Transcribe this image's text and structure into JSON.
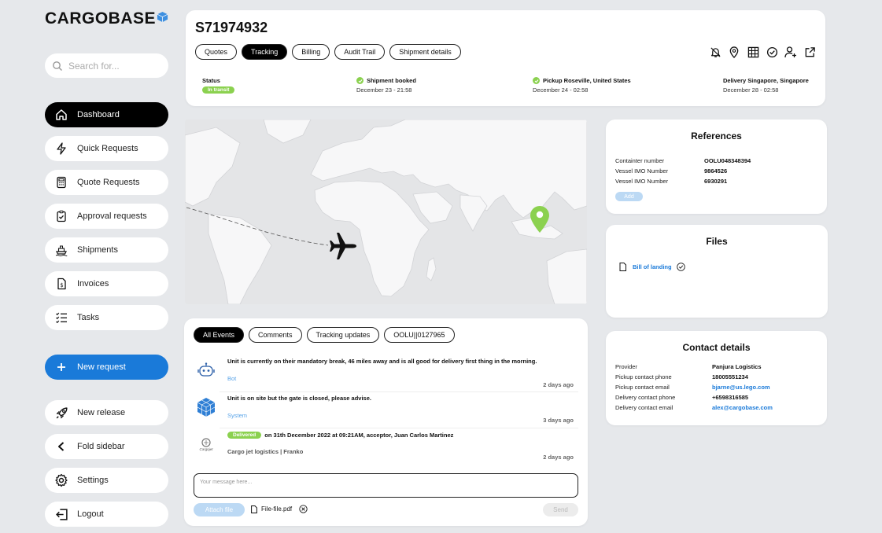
{
  "app": {
    "brand": "CARGOBASE"
  },
  "search": {
    "placeholder": "Search for..."
  },
  "sidebar": {
    "items": [
      {
        "label": "Dashboard"
      },
      {
        "label": "Quick Requests"
      },
      {
        "label": "Quote Requests"
      },
      {
        "label": "Approval requests"
      },
      {
        "label": "Shipments"
      },
      {
        "label": "Invoices"
      },
      {
        "label": "Tasks"
      }
    ],
    "new_request": "New request",
    "bottom": [
      {
        "label": "New release"
      },
      {
        "label": "Fold sidebar"
      },
      {
        "label": "Settings"
      },
      {
        "label": "Logout"
      }
    ]
  },
  "header": {
    "shipment_id": "S71974932",
    "tabs": [
      "Quotes",
      "Tracking",
      "Billing",
      "Audit Trail",
      "Shipment details"
    ],
    "status": {
      "label": "Status",
      "badge": "In transit",
      "booked_label": "Shipment booked",
      "booked_time": "December 23 - 21:58",
      "pickup_label": "Pickup Roseville, United States",
      "pickup_time": "December 24 - 02:58",
      "delivery_label": "Delivery Singapore, Singapore",
      "delivery_time": "December 28 - 02:58"
    }
  },
  "references": {
    "title": "References",
    "rows": [
      {
        "k": "Containter number",
        "v": "OOLU048348394"
      },
      {
        "k": "Vessel IMO Number",
        "v": "9864526"
      },
      {
        "k": "Vessel IMO Number",
        "v": "6930291"
      }
    ],
    "add_label": "Add"
  },
  "files": {
    "title": "Files",
    "items": [
      {
        "name": "Bill of landing"
      }
    ]
  },
  "contact": {
    "title": "Contact details",
    "rows": [
      {
        "k": "Provider",
        "v": "Panjura Logistics"
      },
      {
        "k": "Pickup contact phone",
        "v": "18005551234"
      },
      {
        "k": "Pickup contact email",
        "v": "bjarne@us.lego.com"
      },
      {
        "k": "Delivery contact phone",
        "v": "+6598316585"
      },
      {
        "k": "Delivery contact email",
        "v": "alex@cargobase.com"
      }
    ]
  },
  "events": {
    "tabs": [
      "All Events",
      "Comments",
      "Tracking updates",
      "OOLU||0127965"
    ],
    "items": [
      {
        "text": "Unit is currently on their mandatory break, 46 miles away and is all good for delivery first thing in the morning.",
        "source": "Bot",
        "time": "2 days ago"
      },
      {
        "text": "Unit is on site but the gate is closed, please advise.",
        "source": "System",
        "time": "3 days ago"
      },
      {
        "badge": "Delivered",
        "text": "on 31th December 2022 at 09:21AM, acceptor, Juan Carlos Martinez",
        "source": "Cargo jet logistics | Franko",
        "time": "2 days ago",
        "avatar_text": "Cargojet"
      }
    ],
    "message_placeholder": "Your message here...",
    "attach_label": "Attach file",
    "attached_file": "File-file.pdf",
    "send_label": "Send"
  },
  "colors": {
    "accent": "#1a7ad9",
    "success": "#8bd14f",
    "map_pin": "#8bd14f"
  }
}
